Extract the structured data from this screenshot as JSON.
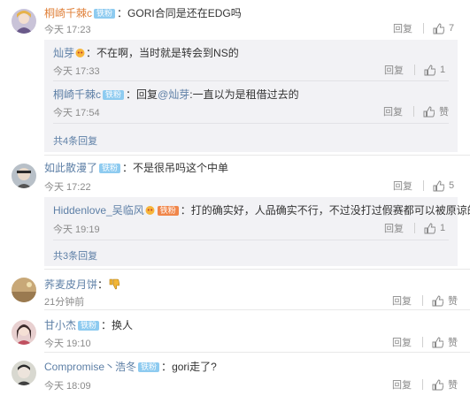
{
  "comments": [
    {
      "author": "桐崎千棘c",
      "badge": "铁粉",
      "text": "GORI合同是还在EDG吗",
      "time": "今天 17:23",
      "reply": "回复",
      "likes": "7",
      "replies": [
        {
          "author": "灿芽",
          "text": "不在啊，当时就是转会到NS的",
          "time": "今天 17:33",
          "reply": "回复",
          "likes": "1"
        },
        {
          "author": "桐崎千棘c",
          "badge": "铁粉",
          "prefix": "回复",
          "mention": "@灿芽",
          "text": ":一直以为是租借过去的",
          "time": "今天 17:54",
          "reply": "回复",
          "likes": "赞"
        }
      ],
      "more": "共4条回复"
    },
    {
      "author": "如此散漫了",
      "badge": "铁粉",
      "text": "不是很吊吗这个中单",
      "time": "今天 17:22",
      "reply": "回复",
      "likes": "5",
      "replies": [
        {
          "author": "Hiddenlove_吴临风",
          "badge": "铁粉",
          "text": "打的确实好，人品确实不行，不过没打过假赛都可以被原谅的",
          "time": "今天 19:19",
          "reply": "回复",
          "likes": "1"
        }
      ],
      "more": "共3条回复"
    },
    {
      "author": "荞麦皮月饼",
      "text": "",
      "time": "21分钟前",
      "reply": "回复",
      "likes": "赞"
    },
    {
      "author": "甘小杰",
      "badge": "铁粉",
      "text": "换人",
      "time": "今天 19:10",
      "reply": "回复",
      "likes": "赞"
    },
    {
      "author": "Compromise丶浩冬",
      "badge": "铁粉",
      "text": "gori走了?",
      "time": "今天 18:09",
      "reply": "回复",
      "likes": "赞"
    }
  ],
  "colors": {
    "name": "#e0813a",
    "link": "#5d7fa6",
    "badge": "#8ecbf0",
    "muted": "#8a8a8a"
  },
  "icons": {
    "like": "thumbs-up-icon"
  }
}
